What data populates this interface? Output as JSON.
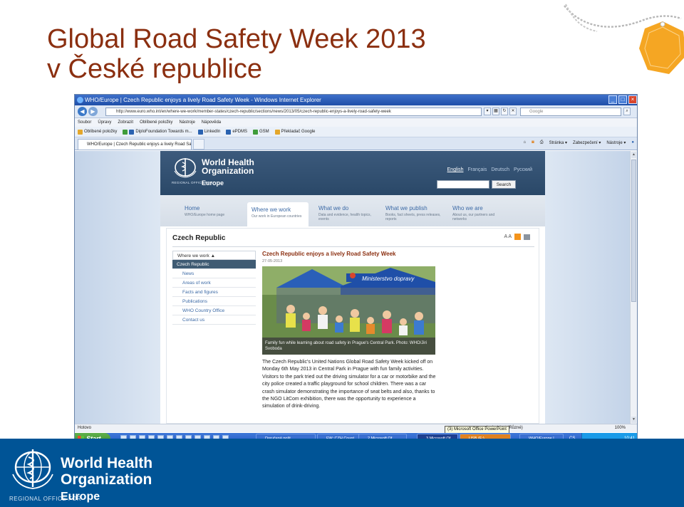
{
  "slide": {
    "title_line1": "Global Road Safety Week 2013",
    "title_line2": "v České republice"
  },
  "browser": {
    "window_title": "WHO/Europe | Czech Republic enjoys a lively Road Safety Week - Windows Internet Explorer",
    "address": "http://www.euro.who.int/en/where-we-work/member-states/czech-republic/sections/news/2013/05/czech-republic-enjoys-a-lively-road-safety-week",
    "search_placeholder": "Google",
    "menu": [
      "Soubor",
      "Úpravy",
      "Zobrazit",
      "Oblíbené položky",
      "Nástroje",
      "Nápověda"
    ],
    "favorites_label": "Oblíbené položky",
    "favorites": [
      "DiploFoundation  Towards m...",
      "LinkedIn",
      "ePDMS",
      "GSM",
      "Překladač Google"
    ],
    "tab_label": "WHO/Europe | Czech Republic enjoys a lively Road Sa...",
    "commands": [
      "Stránka ▾",
      "Zabezpečení ▾",
      "Nástroje ▾"
    ],
    "status_left": "Hotovo",
    "status_zone": "známá oblast (Různé)",
    "status_zoom": "100%",
    "tooltip": "(3) Microsoft Office PowerPoint"
  },
  "who_page": {
    "org_name_line1": "World Health",
    "org_name_line2": "Organization",
    "regional_label": "REGIONAL OFFICE FOR",
    "region": "Europe",
    "languages": [
      "English",
      "Français",
      "Deutsch",
      "Русский"
    ],
    "search_button": "Search",
    "nav": [
      {
        "label": "Home",
        "sub": "WHO/Europe home page"
      },
      {
        "label": "Where we work",
        "sub": "Our work in European countries"
      },
      {
        "label": "What we do",
        "sub": "Data and evidence, health topics, events"
      },
      {
        "label": "What we publish",
        "sub": "Books, fact sheets, press releases, reports"
      },
      {
        "label": "Who we are",
        "sub": "About us, our partners and networks"
      }
    ],
    "country_title": "Czech Republic",
    "tools_text": "A A",
    "left_menu": {
      "head": "Where we work ▲",
      "active": "Czech Republic",
      "items": [
        "News",
        "Areas of work",
        "Facts and figures",
        "Publications",
        "WHO Country Office",
        "Contact us"
      ]
    },
    "article": {
      "title": "Czech Republic enjoys a lively Road Safety Week",
      "date": "27-05-2013",
      "tent_sign": "Ministerstvo dopravy",
      "caption": "Family fun while learning about road safety in Prague's Central Park. Photo: WHO/Jiri Svoboda",
      "body": "The Czech Republic's United Nations Global Road Safety Week kicked off on Monday 6th May 2013 in Central Park in Prague with fun family activities. Visitors to the park tried out the driving simulator for a car or motorbike and the city police created a traffic playground for school children. There was a car crash simulator demonstrating the importance of seat belts and also, thanks to the NGO LitCom exhibition, there was the opportunity to experience a simulation of drink-driving."
    }
  },
  "taskbar": {
    "start": "Start",
    "buttons": [
      "Doručená pošt...",
      "FW: CZH Count...",
      "2 Microsoft Of...",
      "3 Microsoft Of...",
      "USB (E:)",
      "WHO/Europe | ..."
    ],
    "lang": "CS",
    "time": "10:41"
  },
  "footer": {
    "org_name_line1": "World Health",
    "org_name_line2": "Organization",
    "regional_label": "REGIONAL OFFICE FOR",
    "region": "Europe"
  },
  "colors": {
    "title": "#8B2F10",
    "who_blue": "#005496",
    "badge_orange": "#F5A623"
  }
}
